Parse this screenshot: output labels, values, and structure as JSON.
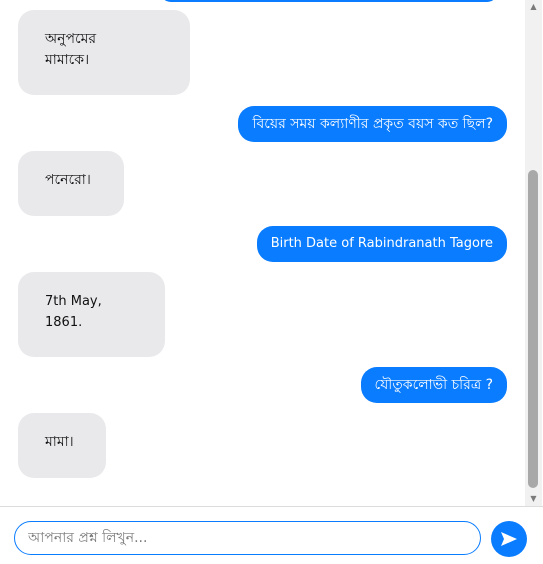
{
  "messages": [
    {
      "sender": "bot",
      "text": "অনুপমের\nমামাকে।"
    },
    {
      "sender": "user",
      "text": "বিয়ের সময় কল্যাণীর প্রকৃত বয়স কত ছিল?"
    },
    {
      "sender": "bot",
      "text": "পনেরো।"
    },
    {
      "sender": "user",
      "text": "Birth Date of Rabindranath Tagore"
    },
    {
      "sender": "bot",
      "text": "7th May,\n1861."
    },
    {
      "sender": "user",
      "text": "যৌতুকলোভী চরিত্র ?"
    },
    {
      "sender": "bot",
      "text": "মামা।"
    }
  ],
  "input": {
    "placeholder": "আপনার প্রশ্ন লিখুন...",
    "value": ""
  },
  "send_button": {
    "icon": "send-arrow-icon"
  },
  "colors": {
    "user_bubble": "#0a7cff",
    "bot_bubble": "#e9e9ec",
    "send_button": "#0a7cff"
  }
}
